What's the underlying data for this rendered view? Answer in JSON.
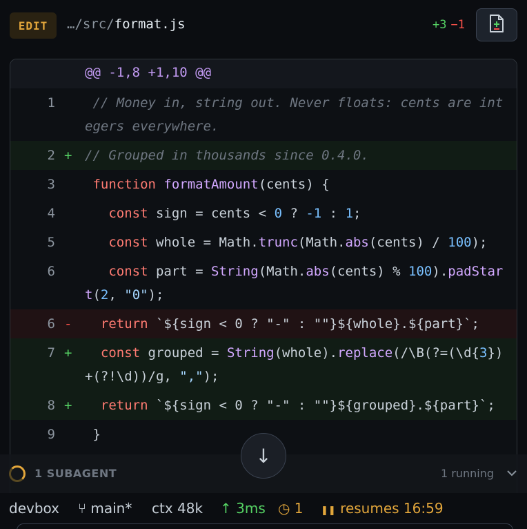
{
  "header": {
    "badge": "EDIT",
    "path_dir": "…/src/",
    "path_file": "format.js",
    "additions": "+3",
    "deletions": "−1",
    "file_icon": "file-diff-icon"
  },
  "diff": {
    "hunk_header": "@@ -1,8 +1,10 @@",
    "rows": [
      {
        "ln": "1",
        "mk": "",
        "type": "context"
      },
      {
        "ln": "2",
        "mk": "+",
        "type": "added"
      },
      {
        "ln": "3",
        "mk": "",
        "type": "context"
      },
      {
        "ln": "4",
        "mk": "",
        "type": "context"
      },
      {
        "ln": "5",
        "mk": "",
        "type": "context"
      },
      {
        "ln": "6",
        "mk": "",
        "type": "context"
      },
      {
        "ln": "6",
        "mk": "-",
        "type": "removed"
      },
      {
        "ln": "7",
        "mk": "+",
        "type": "added"
      },
      {
        "ln": "8",
        "mk": "+",
        "type": "added"
      },
      {
        "ln": "9",
        "mk": "",
        "type": "context"
      }
    ],
    "tokens": {
      "r1": [
        " // Money in, string out. Never floats: cents are integers everywhere."
      ],
      "r2": [
        "// Grouped in thousands since 0.4.0."
      ],
      "r3": [
        " ",
        "function",
        " ",
        "formatAmount",
        "(cents) {"
      ],
      "r4": [
        "   ",
        "const",
        " sign = cents < ",
        "0",
        " ? ",
        "-1",
        " : ",
        "1",
        ";"
      ],
      "r5": [
        "   ",
        "const",
        " whole = Math.",
        "trunc",
        "(Math.",
        "abs",
        "(cents) / ",
        "100",
        ");"
      ],
      "r6": [
        "   ",
        "const",
        " part = ",
        "String",
        "(Math.",
        "abs",
        "(cents) % ",
        "100",
        ").",
        "padStart",
        "(",
        "2",
        ", ",
        "\"0\"",
        ");"
      ],
      "r7": [
        "  ",
        "return",
        " `${sign < 0 ? \"-\" : \"\"}${whole}.${part}`;"
      ],
      "r8": [
        "  ",
        "const",
        " grouped = ",
        "String",
        "(whole).",
        "replace",
        "(/\\B(?=(\\d{",
        "3",
        "})+(?!\\d))/g, ",
        "\",\"",
        ");"
      ],
      "r9": [
        "  ",
        "return",
        " `${sign < 0 ? \"-\" : \"\"}${grouped}.${part}`;"
      ],
      "r10": [
        " }"
      ]
    }
  },
  "subagent": {
    "label": "1 SUBAGENT",
    "running": "1 running",
    "chevron": "chevron-down-icon"
  },
  "scroll_button": {
    "glyph": "↓"
  },
  "status": {
    "host": "devbox",
    "branch_icon": "⑂",
    "branch": "main*",
    "ctx": "ctx 48k",
    "latency": "↑ 3ms",
    "timer": "◷ 1",
    "resume_icon": "❚❚",
    "resume": "resumes 16:59"
  },
  "colors": {
    "accent": "#e2a63b",
    "add": "#56d364",
    "del": "#f85149",
    "keyword": "#ff7b72",
    "function": "#d2a8ff",
    "number": "#79c0ff"
  }
}
